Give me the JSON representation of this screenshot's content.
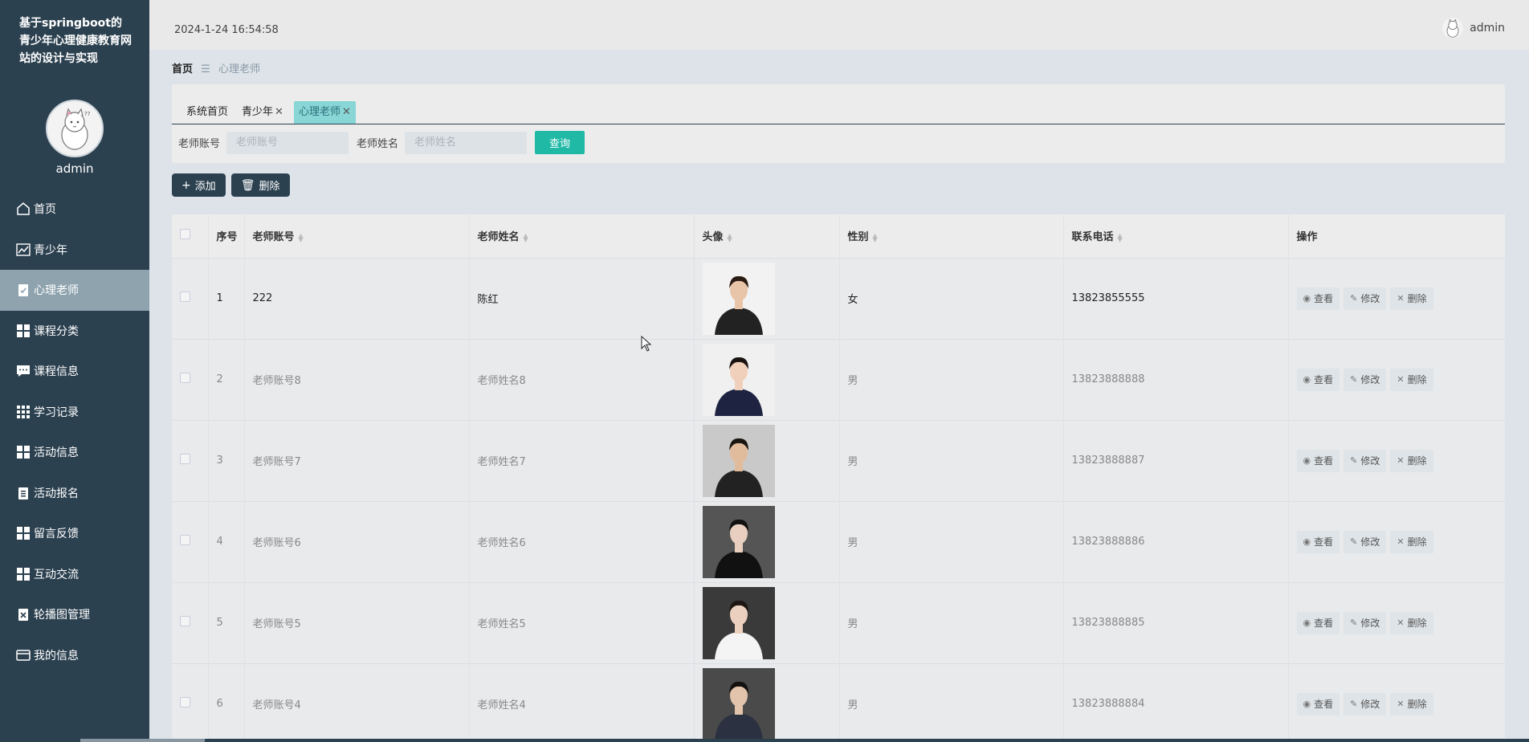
{
  "app": {
    "title": "基于springboot的青少年心理健康教育网站的设计与实现",
    "user": "admin",
    "datetime": "2024-1-24 16:54:58"
  },
  "sidebar": {
    "items": [
      {
        "label": "首页",
        "icon": "home-icon"
      },
      {
        "label": "青少年",
        "icon": "chart-icon"
      },
      {
        "label": "心理老师",
        "icon": "clipboard-check-icon",
        "active": true
      },
      {
        "label": "课程分类",
        "icon": "grid-icon"
      },
      {
        "label": "课程信息",
        "icon": "message-icon"
      },
      {
        "label": "学习记录",
        "icon": "apps-icon"
      },
      {
        "label": "活动信息",
        "icon": "grid-icon"
      },
      {
        "label": "活动报名",
        "icon": "clipboard-icon"
      },
      {
        "label": "留言反馈",
        "icon": "grid-icon"
      },
      {
        "label": "互动交流",
        "icon": "grid-icon"
      },
      {
        "label": "轮播图管理",
        "icon": "clipboard-x-icon"
      },
      {
        "label": "我的信息",
        "icon": "wallet-icon"
      }
    ]
  },
  "breadcrumb": {
    "home": "首页",
    "separator": "☰",
    "current": "心理老师"
  },
  "tabs": [
    {
      "label": "系统首页",
      "closable": false
    },
    {
      "label": "青少年",
      "closable": true
    },
    {
      "label": "心理老师",
      "closable": true,
      "active": true
    }
  ],
  "search": {
    "account_label": "老师账号",
    "account_placeholder": "老师账号",
    "name_label": "老师姓名",
    "name_placeholder": "老师姓名",
    "query_button": "查询"
  },
  "toolbar": {
    "add_label": "添加",
    "delete_label": "删除"
  },
  "table": {
    "headers": {
      "index": "序号",
      "account": "老师账号",
      "name": "老师姓名",
      "photo": "头像",
      "gender": "性别",
      "phone": "联系电话",
      "ops": "操作"
    },
    "ops": {
      "view": "查看",
      "edit": "修改",
      "delete": "删除"
    },
    "rows": [
      {
        "index": "1",
        "account": "222",
        "name": "陈红",
        "gender": "女",
        "phone": "13823855555"
      },
      {
        "index": "2",
        "account": "老师账号8",
        "name": "老师姓名8",
        "gender": "男",
        "phone": "13823888888"
      },
      {
        "index": "3",
        "account": "老师账号7",
        "name": "老师姓名7",
        "gender": "男",
        "phone": "13823888887"
      },
      {
        "index": "4",
        "account": "老师账号6",
        "name": "老师姓名6",
        "gender": "男",
        "phone": "13823888886"
      },
      {
        "index": "5",
        "account": "老师账号5",
        "name": "老师姓名5",
        "gender": "男",
        "phone": "13823888885"
      },
      {
        "index": "6",
        "account": "老师账号4",
        "name": "老师姓名4",
        "gender": "男",
        "phone": "13823888884"
      }
    ]
  },
  "colors": {
    "sidebar": "#2c4150",
    "accent": "#1fb9a6",
    "active_tab": "#88d6d6"
  }
}
